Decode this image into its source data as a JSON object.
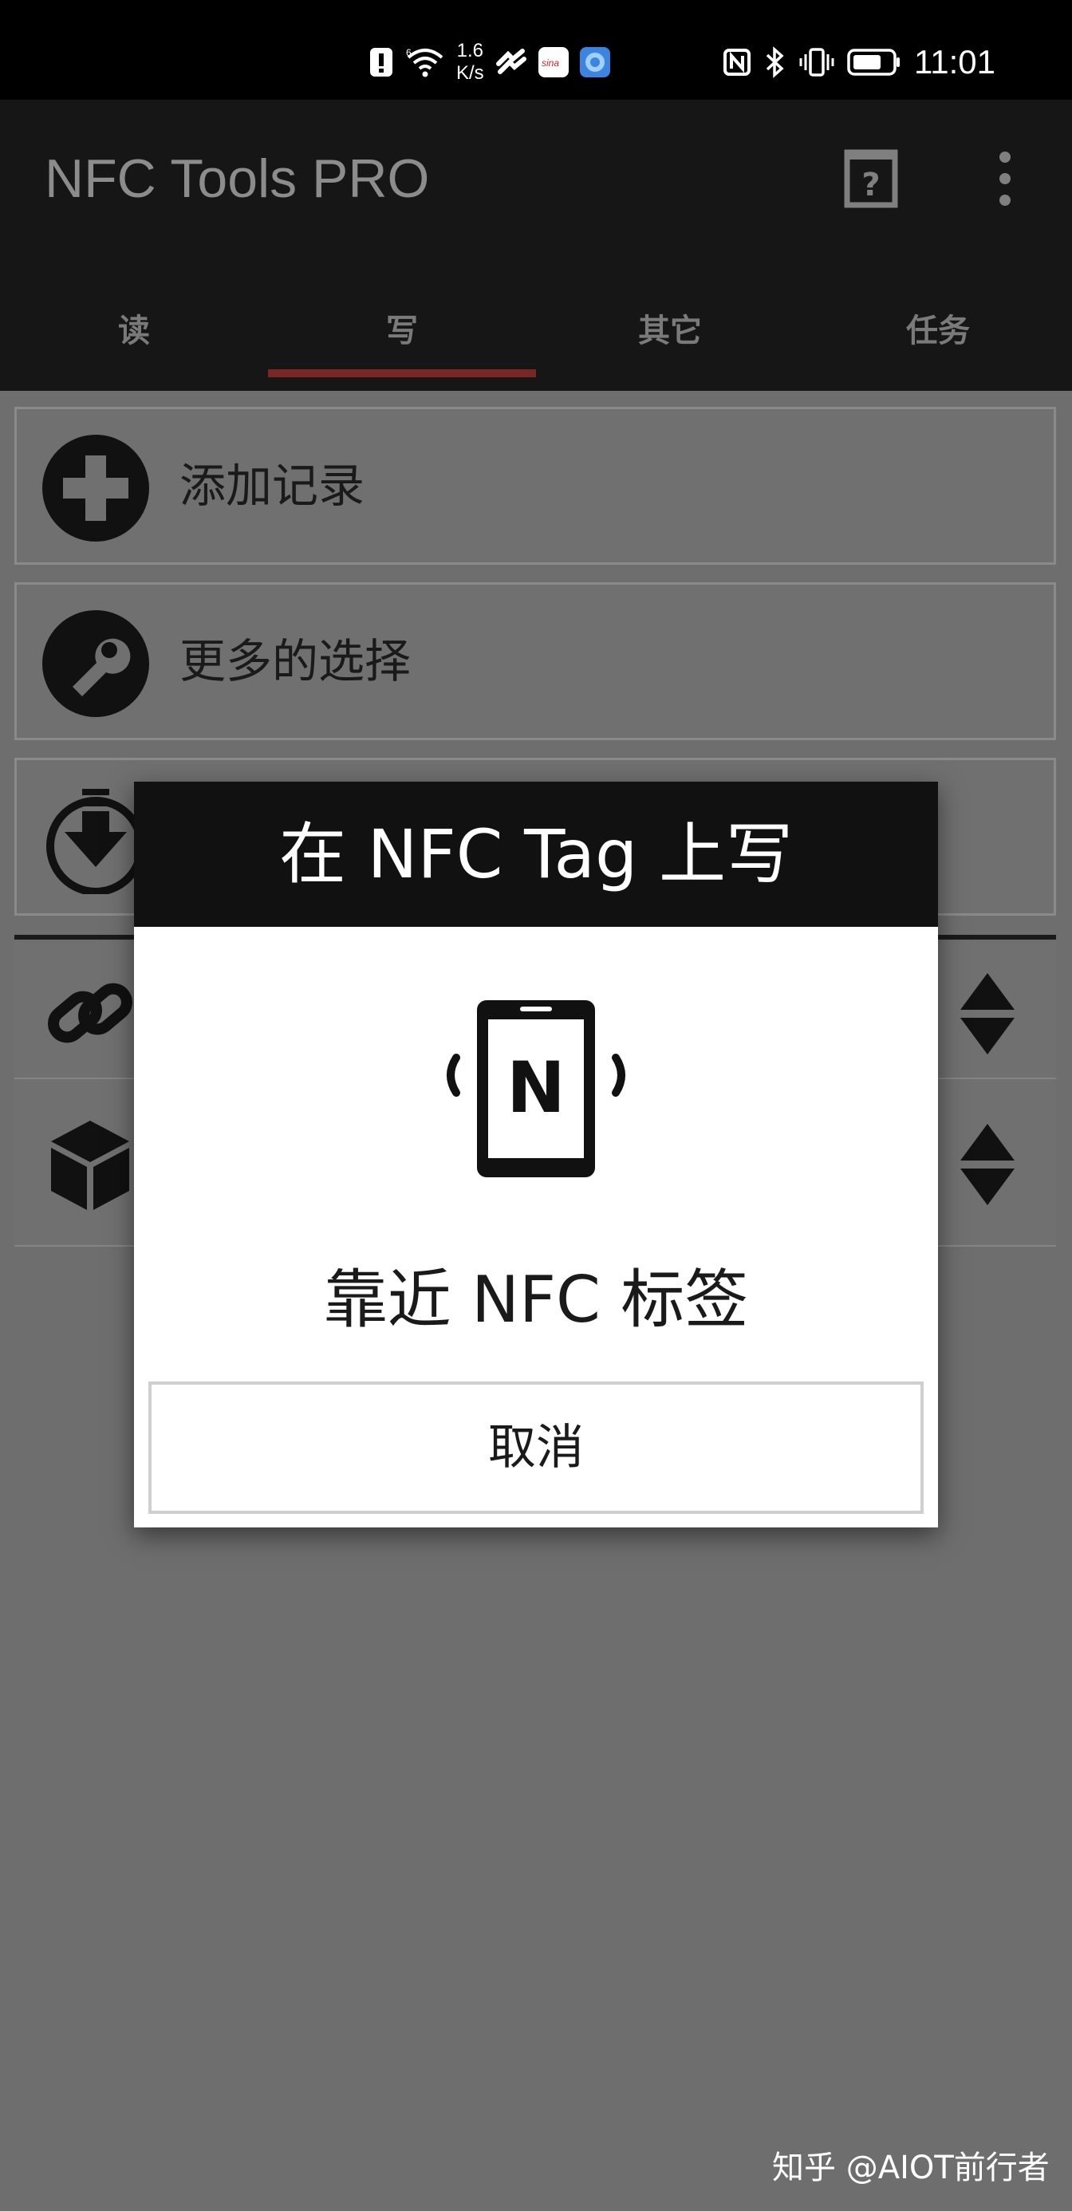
{
  "status_bar": {
    "net_speed_value": "1.6",
    "net_speed_unit": "K/s",
    "time": "11:01",
    "signal_superscript": "6",
    "app_icons": [
      "alert-icon",
      "wifi-icon",
      "huawei-share-icon",
      "sina-weibo-icon",
      "browser-icon"
    ],
    "right_icons": [
      "nfc-icon",
      "bluetooth-icon",
      "vibrate-icon",
      "battery-icon"
    ]
  },
  "app_bar": {
    "title": "NFC Tools PRO",
    "icons": [
      "help-icon",
      "overflow-menu-icon"
    ]
  },
  "tabs": [
    {
      "label": "读",
      "active": false
    },
    {
      "label": "写",
      "active": true
    },
    {
      "label": "其它",
      "active": false
    },
    {
      "label": "任务",
      "active": false
    }
  ],
  "list": [
    {
      "label": "添加记录",
      "icon": "plus-circle-icon"
    },
    {
      "label": "更多的选择",
      "icon": "wrench-circle-icon"
    },
    {
      "label": "",
      "icon": "download-circle-icon"
    }
  ],
  "records": [
    {
      "icon": "link-icon",
      "sort_icon": "sort-arrows-icon"
    },
    {
      "icon": "cube-icon",
      "sort_icon": "sort-arrows-icon"
    }
  ],
  "dialog": {
    "title": "在 NFC Tag 上写",
    "message": "靠近 NFC 标签",
    "cancel_label": "取消",
    "phone_letter": "N"
  },
  "watermark": "知乎 @AIOT前行者",
  "colors": {
    "status_bar_bg": "#000000",
    "app_bar_bg": "#161616",
    "tab_indicator": "#7a2626",
    "overlay_bg": "#6e6e6e",
    "dialog_header_bg": "#111111"
  }
}
